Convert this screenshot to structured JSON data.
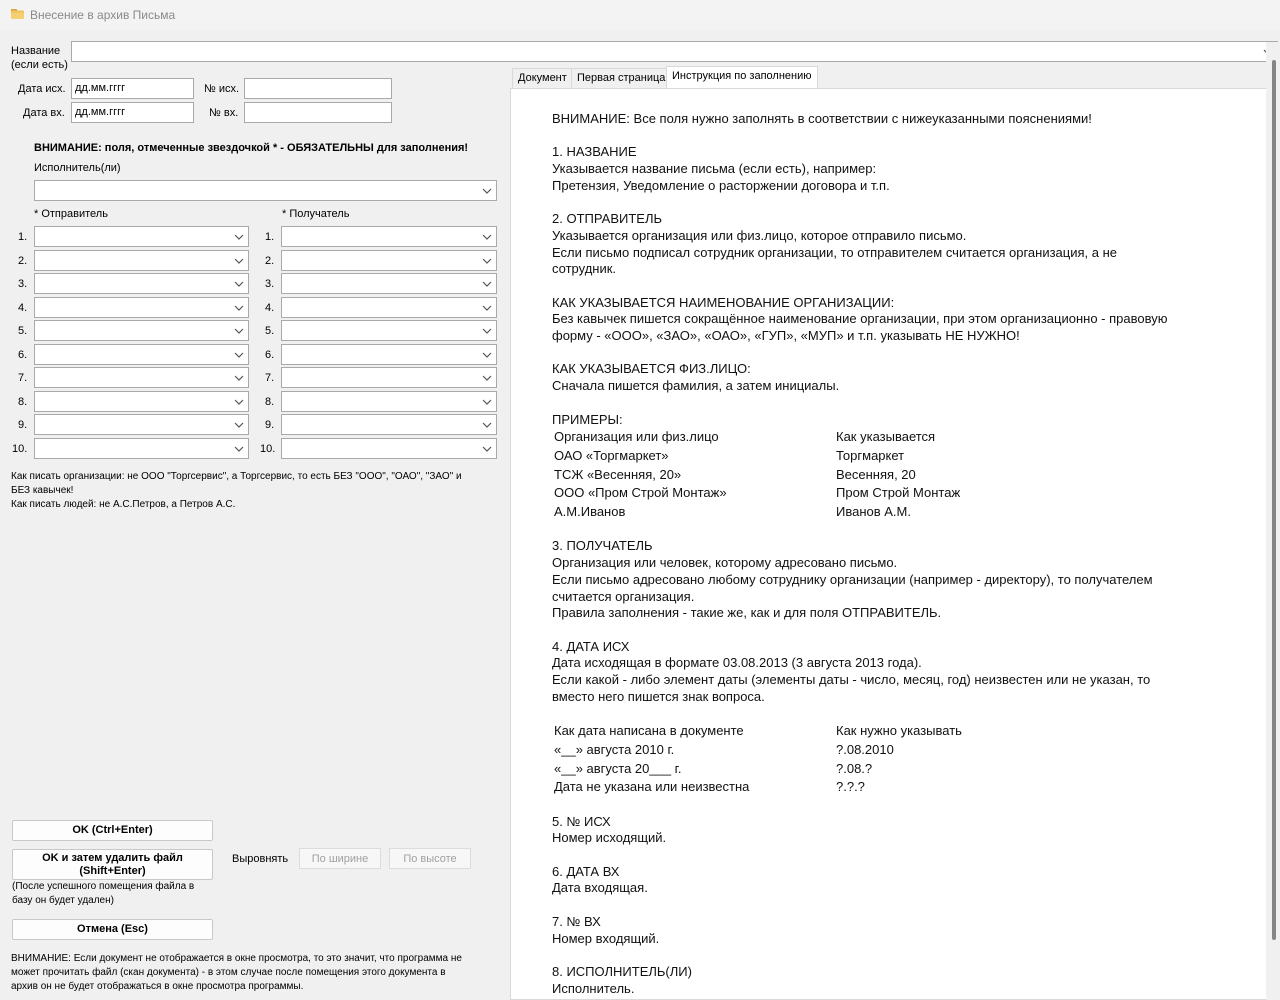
{
  "window": {
    "title": "Внесение в архив Письма",
    "icon": "folder-icon"
  },
  "form": {
    "name_label_line1": "Название",
    "name_label_line2": "(если есть)",
    "name_value": "",
    "date_out_label": "Дата исх.",
    "date_out_value": "дд.мм.гггг",
    "num_out_label": "№ исх.",
    "num_out_value": "",
    "date_in_label": "Дата вх.",
    "date_in_value": "дд.мм.гггг",
    "num_in_label": "№ вх.",
    "num_in_value": "",
    "warning": "ВНИМАНИЕ: поля, отмеченные звездочкой * - ОБЯЗАТЕЛЬНЫ для заполнения!",
    "executor_label": "Исполнитель(ли)",
    "sender_label": "* Отправитель",
    "recipient_label": "* Получатель",
    "row_numbers": [
      "1.",
      "2.",
      "3.",
      "4.",
      "5.",
      "6.",
      "7.",
      "8.",
      "9.",
      "10."
    ],
    "hint_org_line1": "Как писать организации: не ООО \"Торгсервис\", а Торгсервис, то есть БЕЗ \"ООО\", \"ОАО\", \"ЗАО\" и",
    "hint_org_line2": "БЕЗ кавычек!",
    "hint_people": "Как писать людей: не А.С.Петров, а Петров А.С."
  },
  "buttons": {
    "ok": "OK (Ctrl+Enter)",
    "ok_delete_line1": "OK и затем удалить файл",
    "ok_delete_line2": "(Shift+Enter)",
    "ok_delete_note_line1": "(После успешного помещения файла в",
    "ok_delete_note_line2": "базу он будет удален)",
    "cancel": "Отмена (Esc)",
    "align_label": "Выровнять",
    "by_width": "По ширине",
    "by_height": "По высоте"
  },
  "bottom_note": {
    "line1": "ВНИМАНИЕ: Если документ не отображается в окне просмотра, то это значит, что программа не",
    "line2": "может прочитать файл (скан документа) - в этом случае после помещения этого документа в",
    "line3": "архив он не будет отображаться в окне просмотра программы."
  },
  "tabs": [
    {
      "label": "Документ",
      "active": false
    },
    {
      "label": "Первая страница",
      "active": false
    },
    {
      "label": "Инструкция по заполнению",
      "active": true
    }
  ],
  "instructions": {
    "attention": "ВНИМАНИЕ: Все поля нужно заполнять в соответствии с нижеуказанными пояснениями!",
    "s1_title": "1. НАЗВАНИЕ",
    "s1_l1": "Указывается название письма (если есть), например:",
    "s1_l2": "Претензия, Уведомление о расторжении договора и т.п.",
    "s2_title": "2. ОТПРАВИТЕЛЬ",
    "s2_l1": "Указывается организация или физ.лицо, которое отправило письмо.",
    "s2_l2": "Если письмо подписал сотрудник организации, то отправителем считается организация, а не",
    "s2_l3": "сотрудник.",
    "org_title": "КАК УКАЗЫВАЕТСЯ НАИМЕНОВАНИЕ ОРГАНИЗАЦИИ:",
    "org_l1": "Без кавычек пишется сокращённое наименование организации, при этом организационно - правовую",
    "org_l2": "форму - «ООО», «ЗАО», «ОАО», «ГУП», «МУП» и т.п. указывать НЕ НУЖНО!",
    "fiz_title": "КАК УКАЗЫВАЕТСЯ ФИЗ.ЛИЦО:",
    "fiz_l1": "Сначала пишется фамилия, а затем инициалы.",
    "examples_title": "ПРИМЕРЫ:",
    "examples": [
      [
        "Организация или физ.лицо",
        "Как указывается"
      ],
      [
        "ОАО «Торгмаркет»",
        "Торгмаркет"
      ],
      [
        "ТСЖ «Весенняя, 20»",
        "Весенняя, 20"
      ],
      [
        "ООО «Пром Строй Монтаж»",
        "Пром Строй Монтаж"
      ],
      [
        "А.М.Иванов",
        "Иванов А.М."
      ]
    ],
    "s3_title": "3. ПОЛУЧАТЕЛЬ",
    "s3_l1": "Организация или человек, которому адресовано письмо.",
    "s3_l2": "Если письмо адресовано любому сотруднику организации (например - директору), то получателем",
    "s3_l3": "считается организация.",
    "s3_l4": "Правила заполнения - такие же, как и для поля ОТПРАВИТЕЛЬ.",
    "s4_title": "4. ДАТА ИСХ",
    "s4_l1": "Дата исходящая в формате 03.08.2013 (3 августа 2013 года).",
    "s4_l2": "Если какой - либо элемент даты (элементы даты - число, месяц, год) неизвестен или не указан, то",
    "s4_l3": "вместо него пишется знак вопроса.",
    "dates": [
      [
        "Как дата написана в документе",
        "Как нужно указывать"
      ],
      [
        "«__» августа 2010 г.",
        "?.08.2010"
      ],
      [
        "«__» августа 20___ г.",
        "?.08.?"
      ],
      [
        "Дата не указана или неизвестна",
        "?.?.?"
      ]
    ],
    "s5_title": "5. № ИСХ",
    "s5_l1": "Номер исходящий.",
    "s6_title": "6. ДАТА ВХ",
    "s6_l1": "Дата входящая.",
    "s7_title": "7. № ВХ",
    "s7_l1": "Номер входящий.",
    "s8_title": "8. ИСПОЛНИТЕЛЬ(ЛИ)",
    "s8_l1": "Исполнитель."
  }
}
